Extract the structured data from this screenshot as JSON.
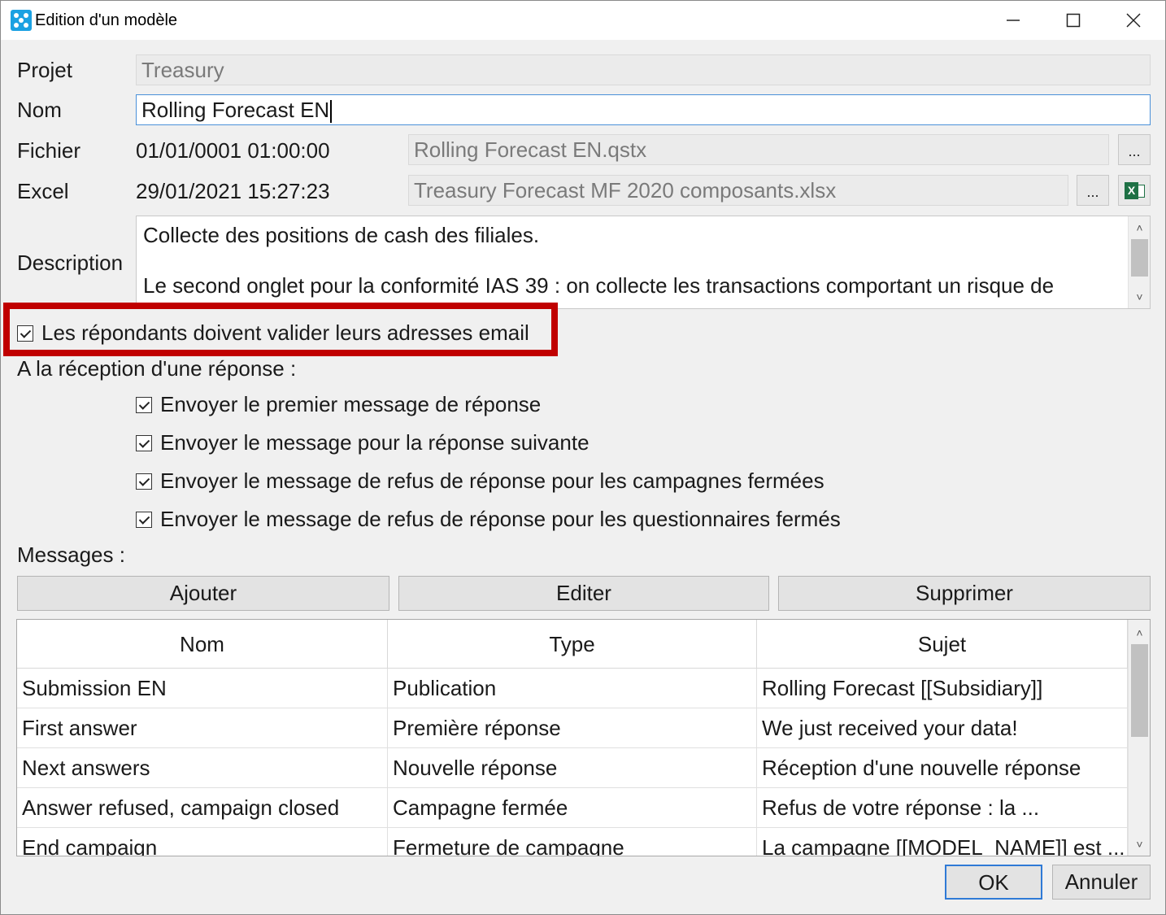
{
  "window": {
    "title": "Edition d'un modèle"
  },
  "fields": {
    "projet_label": "Projet",
    "projet_value": "Treasury",
    "nom_label": "Nom",
    "nom_value": "Rolling Forecast EN",
    "fichier_label": "Fichier",
    "fichier_date": "01/01/0001 01:00:00",
    "fichier_value": "Rolling Forecast EN.qstx",
    "excel_label": "Excel",
    "excel_date": "29/01/2021 15:27:23",
    "excel_value": "Treasury Forecast MF 2020 composants.xlsx",
    "browse_label": "...",
    "excel_icon": "excel-icon",
    "description_label": "Description",
    "description_value": "Collecte des positions de cash des filiales.\n\nLe second onglet pour la conformité IAS 39 : on collecte les transactions comportant un risque de change."
  },
  "validate_email": {
    "label": "Les répondants doivent valider leurs adresses email",
    "checked": true
  },
  "reception": {
    "label": "A la réception d'une réponse :",
    "options": [
      {
        "label": "Envoyer le premier message de réponse",
        "checked": true
      },
      {
        "label": "Envoyer le message pour la réponse suivante",
        "checked": true
      },
      {
        "label": "Envoyer le message de refus de réponse pour les campagnes fermées",
        "checked": true
      },
      {
        "label": "Envoyer le message de refus de réponse pour les questionnaires fermés",
        "checked": true
      }
    ]
  },
  "messages": {
    "label": "Messages :",
    "buttons": {
      "add": "Ajouter",
      "edit": "Editer",
      "delete": "Supprimer"
    },
    "columns": [
      "Nom",
      "Type",
      "Sujet"
    ],
    "rows": [
      [
        "Submission EN",
        "Publication",
        "Rolling Forecast [[Subsidiary]]"
      ],
      [
        "First answer",
        "Première réponse",
        "We just received your data!"
      ],
      [
        "Next answers",
        "Nouvelle réponse",
        "Réception d'une nouvelle réponse"
      ],
      [
        "Answer refused, campaign closed",
        "Campagne fermée",
        "Refus de votre réponse : la ..."
      ],
      [
        "End campaign",
        "Fermeture de campagne",
        "La campagne [[MODEL_NAME]] est ..."
      ]
    ]
  },
  "footer": {
    "ok": "OK",
    "cancel": "Annuler"
  }
}
